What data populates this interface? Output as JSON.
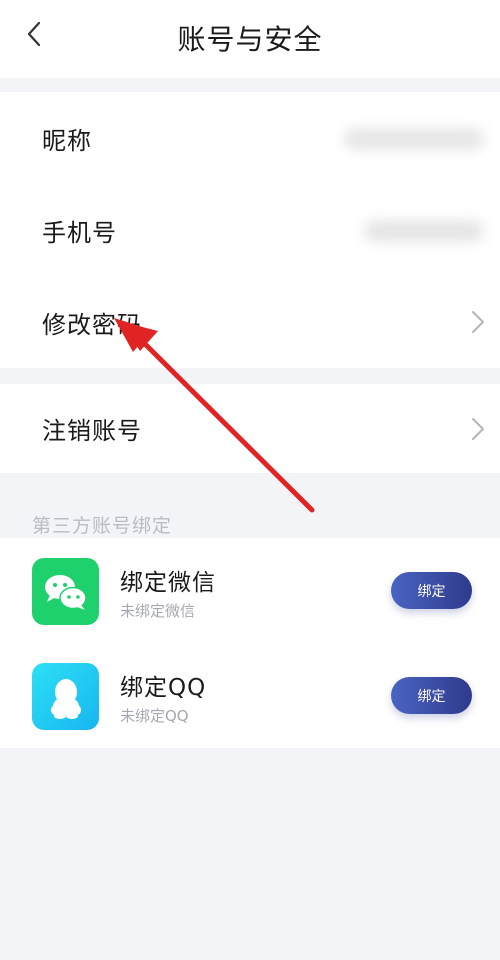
{
  "header": {
    "title": "账号与安全",
    "back_icon": "chevron-left-icon"
  },
  "account_rows": [
    {
      "label": "昵称",
      "value": "",
      "value_blurred": true
    },
    {
      "label": "手机号",
      "value": "",
      "value_blurred": true
    },
    {
      "label": "修改密码",
      "icon": "chevron-right-icon"
    }
  ],
  "deactivate_row": {
    "label": "注销账号",
    "icon": "chevron-right-icon"
  },
  "third_party": {
    "section_title": "第三方账号绑定",
    "items": [
      {
        "title": "绑定微信",
        "status": "未绑定微信",
        "button_label": "绑定",
        "icon": "wechat-icon",
        "icon_color": "#1fd16c"
      },
      {
        "title": "绑定QQ",
        "status": "未绑定QQ",
        "button_label": "绑定",
        "icon": "qq-icon",
        "icon_color": "#17b6f0"
      }
    ]
  },
  "colors": {
    "background": "#f3f4f8",
    "bind_button": "#3b4ca8",
    "arrow": "#e02424"
  }
}
